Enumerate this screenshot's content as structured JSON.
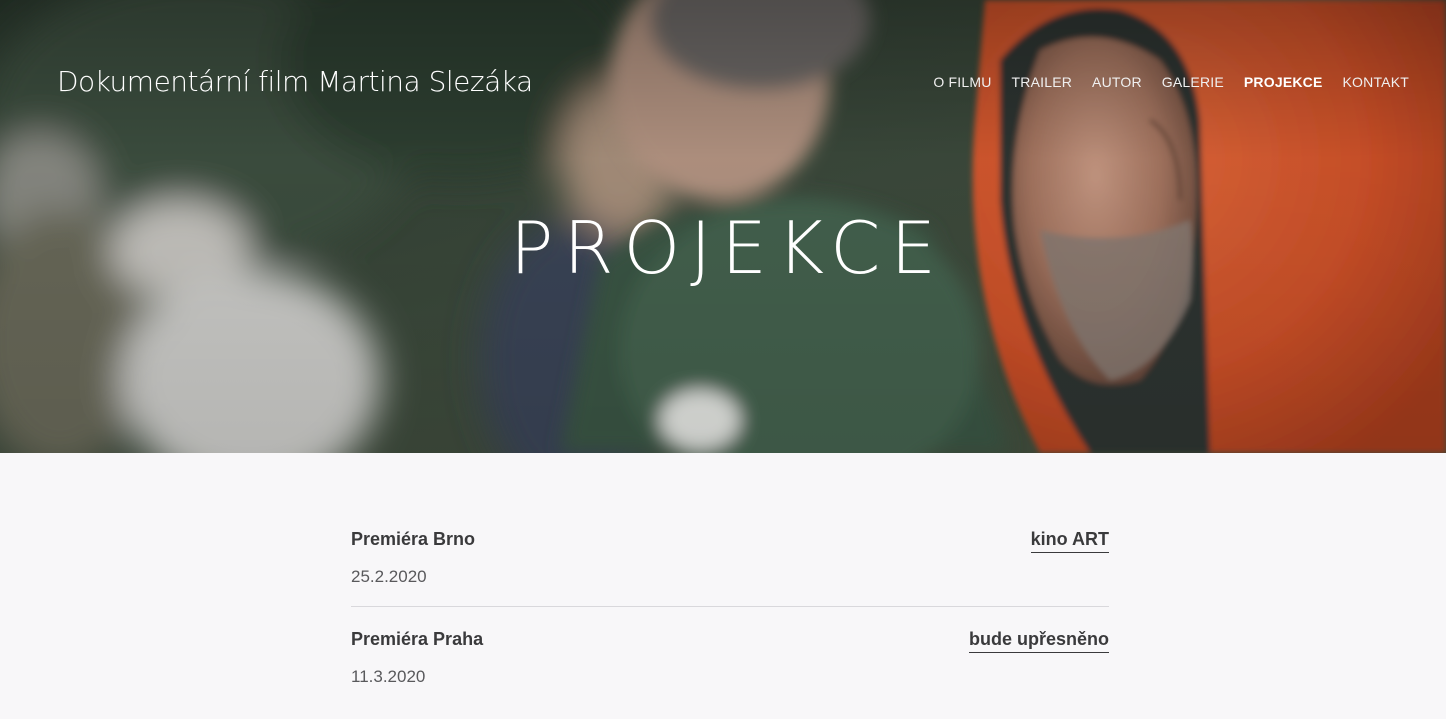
{
  "header": {
    "site_title": "Dokumentární film Martina Slezáka"
  },
  "nav": {
    "items": [
      {
        "label": "O FILMU"
      },
      {
        "label": "TRAILER"
      },
      {
        "label": "AUTOR"
      },
      {
        "label": "GALERIE"
      },
      {
        "label": "PROJEKCE",
        "active": true
      },
      {
        "label": "KONTAKT"
      }
    ]
  },
  "hero": {
    "heading": "PROJEKCE",
    "image": "film-still-men-in-forest-one-in-orange-hood"
  },
  "screenings": [
    {
      "name": "Premiéra Brno",
      "date": "25.2.2020",
      "venue": "kino ART"
    },
    {
      "name": "Premiéra Praha",
      "date": "11.3.2020",
      "venue": "bude upřesněno"
    }
  ],
  "colors": {
    "background": "#f8f7f9",
    "text_dark": "#3a3a3c",
    "text_muted": "#59595c",
    "divider": "#d9d8dc",
    "hood_orange": "#d65a30"
  }
}
